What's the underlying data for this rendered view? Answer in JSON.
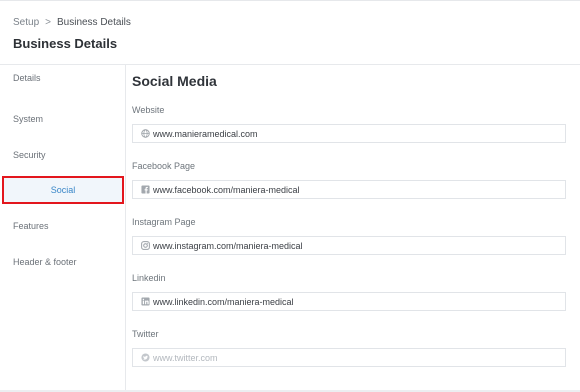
{
  "breadcrumb": {
    "root": "Setup",
    "separator": ">",
    "current": "Business Details"
  },
  "page": {
    "title": "Business Details"
  },
  "sidebar": {
    "items": [
      {
        "label": "Details",
        "active": false
      },
      {
        "label": "System",
        "active": false
      },
      {
        "label": "Security",
        "active": false
      },
      {
        "label": "Social",
        "active": true
      },
      {
        "label": "Features",
        "active": false
      },
      {
        "label": "Header & footer",
        "active": false
      }
    ]
  },
  "content": {
    "section_title": "Social Media",
    "fields": [
      {
        "label": "Website",
        "value": "www.manieramedical.com",
        "placeholder": "",
        "icon": "globe-icon"
      },
      {
        "label": "Facebook Page",
        "value": "www.facebook.com/maniera-medical",
        "placeholder": "",
        "icon": "facebook-icon"
      },
      {
        "label": "Instagram Page",
        "value": "www.instagram.com/maniera-medical",
        "placeholder": "",
        "icon": "instagram-icon"
      },
      {
        "label": "Linkedin",
        "value": "www.linkedin.com/maniera-medical",
        "placeholder": "",
        "icon": "linkedin-icon"
      },
      {
        "label": "Twitter",
        "value": "",
        "placeholder": "www.twitter.com",
        "icon": "twitter-icon"
      }
    ]
  },
  "colors": {
    "active_text": "#3a87c8",
    "active_bg": "#f1f6fb",
    "highlight_border": "#e3161d"
  }
}
